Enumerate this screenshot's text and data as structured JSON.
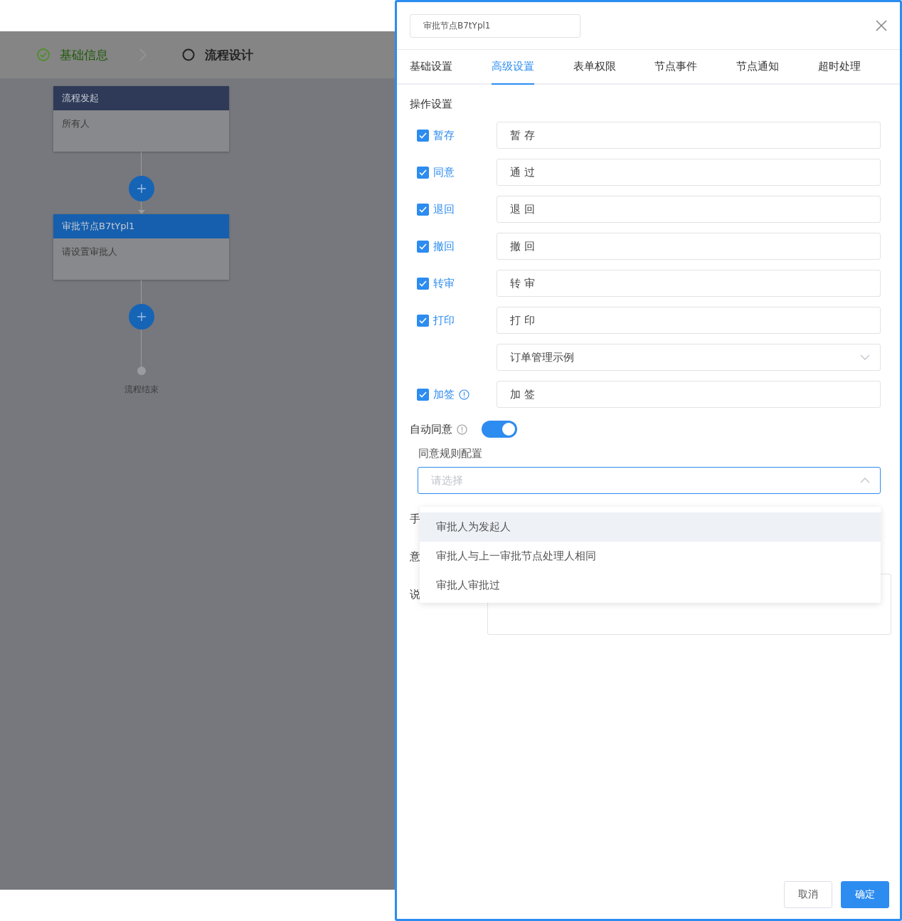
{
  "steps": [
    {
      "label": "基础信息",
      "done": true
    },
    {
      "label": "流程设计",
      "done": false
    }
  ],
  "flow": {
    "nodes": [
      {
        "kind": "start",
        "title": "流程发起",
        "body": "所有人"
      },
      {
        "kind": "approval",
        "title": "审批节点B7tYpl1",
        "body": "请设置审批人"
      }
    ],
    "end_label": "流程结束"
  },
  "drawer": {
    "name_value": "审批节点B7tYpl1",
    "tabs": [
      {
        "label": "基础设置",
        "selected": false
      },
      {
        "label": "高级设置",
        "selected": true
      },
      {
        "label": "表单权限",
        "selected": false
      },
      {
        "label": "节点事件",
        "selected": false
      },
      {
        "label": "节点通知",
        "selected": false
      },
      {
        "label": "超时处理",
        "selected": false
      }
    ],
    "section_title": "操作设置",
    "operations": [
      {
        "kind": "checkbox",
        "label": "暂存",
        "checked": true,
        "value": "暂 存"
      },
      {
        "kind": "checkbox",
        "label": "同意",
        "checked": true,
        "value": "通 过"
      },
      {
        "kind": "checkbox",
        "label": "退回",
        "checked": true,
        "value": "退 回"
      },
      {
        "kind": "checkbox",
        "label": "撤回",
        "checked": true,
        "value": "撤 回"
      },
      {
        "kind": "checkbox",
        "label": "转审",
        "checked": true,
        "value": "转 审"
      },
      {
        "kind": "checkbox",
        "label": "打印",
        "checked": true,
        "value": "打 印"
      },
      {
        "kind": "select",
        "value": "订单管理示例"
      },
      {
        "kind": "checkbox",
        "label": "加签",
        "checked": true,
        "value": "加 签",
        "info": true
      }
    ],
    "auto_agree": {
      "label": "自动同意",
      "on": true
    },
    "rule": {
      "label": "同意规则配置",
      "placeholder": "请选择",
      "options": [
        {
          "label": "审批人为发起人",
          "highlighted": true
        },
        {
          "label": "审批人与上一审批节点处理人相同",
          "highlighted": false
        },
        {
          "label": "审批人审批过",
          "highlighted": false
        }
      ]
    },
    "hidden_labels": [
      "手",
      "意",
      "说"
    ],
    "buttons": [
      {
        "label": "取消",
        "kind": "default"
      },
      {
        "label": "确定",
        "kind": "primary"
      }
    ]
  }
}
